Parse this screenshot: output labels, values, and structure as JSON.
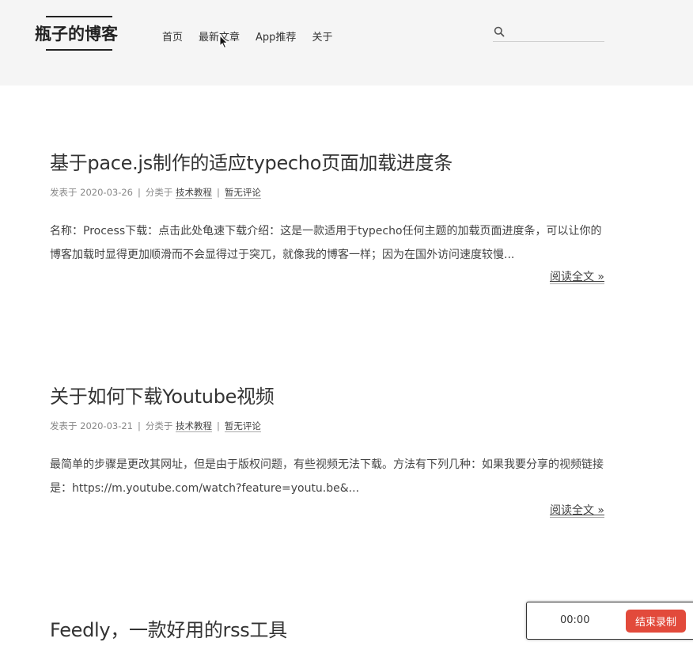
{
  "header": {
    "logo": "瓶子的博客",
    "nav": [
      "首页",
      "最新文章",
      "App推荐",
      "关于"
    ],
    "search": {
      "placeholder": "",
      "value": ""
    }
  },
  "posts": [
    {
      "title": "基于pace.js制作的适应typecho页面加载进度条",
      "date_prefix": "发表于 2020-03-26",
      "category_prefix": "分类于",
      "category": "技术教程",
      "comments": "暂无评论",
      "excerpt": "名称：Process下载：点击此处龟速下载介绍：这是一款适用于typecho任何主题的加载页面进度条，可以让你的博客加载时显得更加顺滑而不会显得过于突兀，就像我的博客一样；因为在国外访问速度较慢...",
      "read_more": "阅读全文 »"
    },
    {
      "title": "关于如何下载Youtube视频",
      "date_prefix": "发表于 2020-03-21",
      "category_prefix": "分类于",
      "category": "技术教程",
      "comments": "暂无评论",
      "excerpt": "最简单的步骤是更改其网址，但是由于版权问题，有些视频无法下载。方法有下列几种：如果我要分享的视频链接是：https://m.youtube.com/watch?feature=youtu.be&...",
      "read_more": "阅读全文 »"
    },
    {
      "title": "Feedly，一款好用的rss工具"
    }
  ],
  "recorder": {
    "time": "00:00",
    "stop_label": "结束录制",
    "accent": "#e24a3b"
  }
}
